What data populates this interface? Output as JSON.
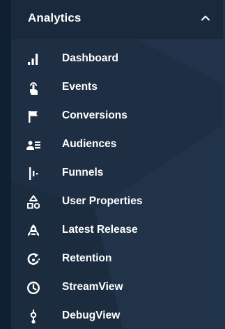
{
  "section": {
    "title": "Analytics",
    "expanded": true,
    "colors": {
      "background": "#1e2e40",
      "text": "#ffffff"
    }
  },
  "nav": {
    "items": [
      {
        "label": "Dashboard",
        "icon": "bar-chart-icon"
      },
      {
        "label": "Events",
        "icon": "touch-icon"
      },
      {
        "label": "Conversions",
        "icon": "flag-icon"
      },
      {
        "label": "Audiences",
        "icon": "audience-icon"
      },
      {
        "label": "Funnels",
        "icon": "funnel-icon"
      },
      {
        "label": "User Properties",
        "icon": "user-properties-icon"
      },
      {
        "label": "Latest Release",
        "icon": "release-icon"
      },
      {
        "label": "Retention",
        "icon": "retention-icon"
      },
      {
        "label": "StreamView",
        "icon": "clock-icon"
      },
      {
        "label": "DebugView",
        "icon": "debug-icon"
      }
    ]
  }
}
